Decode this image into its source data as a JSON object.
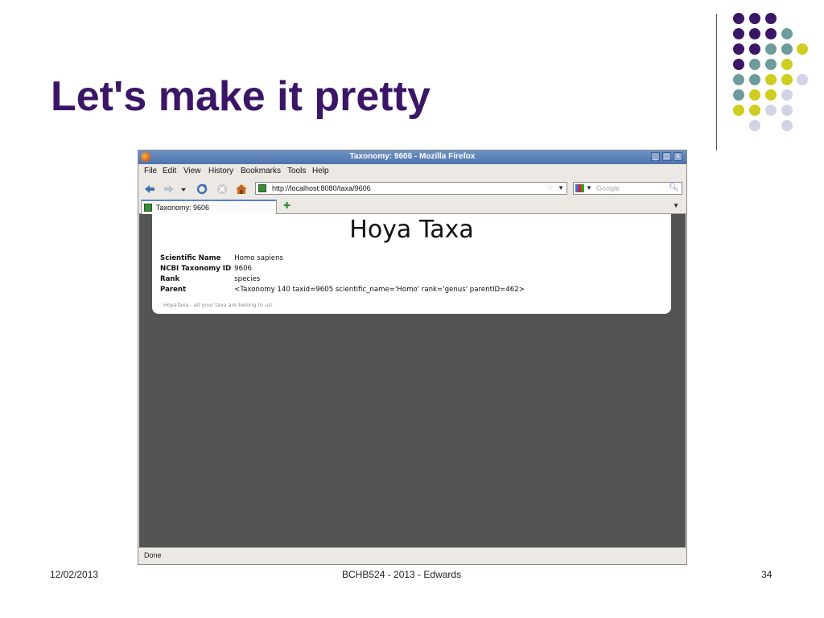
{
  "slide": {
    "title": "Let's make it pretty",
    "footer_date": "12/02/2013",
    "footer_center": "BCHB524 - 2013 - Edwards",
    "page_number": "34",
    "colors": {
      "title": "#3b1566",
      "dot_purple": "#3b1566",
      "dot_teal": "#6e9c9c",
      "dot_yellow": "#cfcd1f",
      "dot_lavender": "#d3d3e6"
    }
  },
  "browser": {
    "window_title": "Taxonomy: 9606 - Mozilla Firefox",
    "menu": [
      "File",
      "Edit",
      "View",
      "History",
      "Bookmarks",
      "Tools",
      "Help"
    ],
    "url": "http://localhost:8080/taxa/9606",
    "search_placeholder": "Google",
    "tab_label": "Taxonomy: 9606",
    "status": "Done"
  },
  "page": {
    "heading": "Hoya Taxa",
    "rows": [
      {
        "key": "Scientific Name",
        "value": "Homo sapiens"
      },
      {
        "key": "NCBI Taxonomy ID",
        "value": "9606"
      },
      {
        "key": "Rank",
        "value": "species"
      },
      {
        "key": "Parent",
        "value": "<Taxonomy 140 taxid=9605 scientific_name='Homo' rank='genus' parentID=462>"
      }
    ],
    "footer": "HoyaTaxa - all your taxa are belong to us!"
  }
}
